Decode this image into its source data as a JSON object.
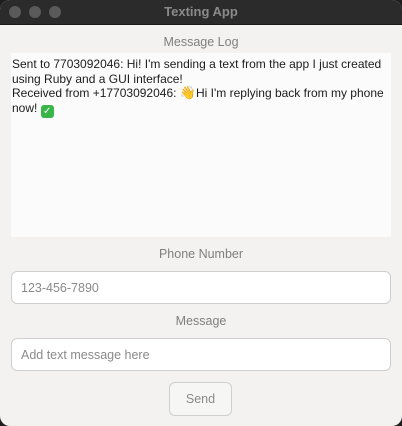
{
  "window": {
    "title": "Texting App"
  },
  "message_log": {
    "label": "Message Log",
    "entries": [
      {
        "text": "Sent to 7703092046: Hi! I'm sending a text from the app I just created using Ruby and a GUI interface!"
      },
      {
        "text_before": "Received from +17703092046: ",
        "emoji": "👋",
        "emoji_icon": "waving-hand-icon",
        "text_after": "Hi I'm replying back  from my phone now! ",
        "trailing_icon": "check-mark-icon",
        "trailing_glyph": "✓"
      }
    ]
  },
  "phone_number": {
    "label": "Phone Number",
    "placeholder": "123-456-7890",
    "value": ""
  },
  "message": {
    "label": "Message",
    "placeholder": "Add text message here",
    "value": ""
  },
  "send_button": {
    "label": "Send"
  },
  "colors": {
    "titlebar": "#2b2b2b",
    "window_bg": "#f3f2f0",
    "log_bg": "#fbfbfb",
    "check_emoji": "#3ab54a"
  }
}
